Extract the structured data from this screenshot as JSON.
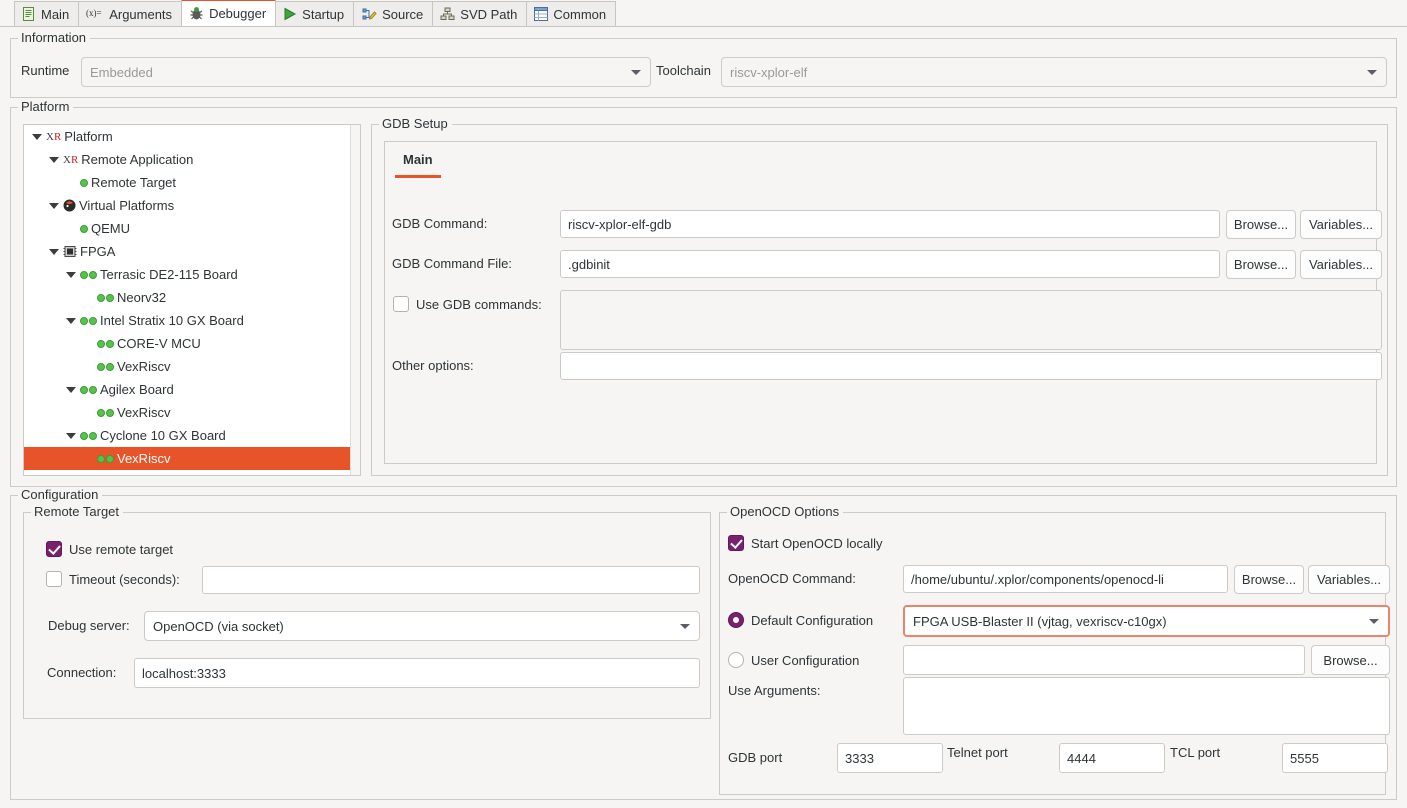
{
  "window": {
    "tabs": [
      {
        "label": "Main",
        "icon": "document-icon",
        "active": false
      },
      {
        "label": "Arguments",
        "icon": "arguments-icon",
        "active": false
      },
      {
        "label": "Debugger",
        "icon": "bug-icon",
        "active": true
      },
      {
        "label": "Startup",
        "icon": "play-icon",
        "active": false
      },
      {
        "label": "Source",
        "icon": "source-edit-icon",
        "active": false
      },
      {
        "label": "SVD Path",
        "icon": "hierarchy-icon",
        "active": false
      },
      {
        "label": "Common",
        "icon": "table-icon",
        "active": false
      }
    ]
  },
  "information": {
    "legend": "Information",
    "runtime_label": "Runtime",
    "runtime_value": "Embedded",
    "toolchain_label": "Toolchain",
    "toolchain_value": "riscv-xplor-elf"
  },
  "platform": {
    "legend": "Platform",
    "tree": [
      {
        "label": "Platform",
        "indent": 0,
        "twisty": "open",
        "icon": "xr-icon",
        "selected": false
      },
      {
        "label": "Remote Application",
        "indent": 1,
        "twisty": "open",
        "icon": "xr-icon",
        "selected": false
      },
      {
        "label": "Remote Target",
        "indent": 2,
        "twisty": "none",
        "icon": "green-dot-icon",
        "selected": false
      },
      {
        "label": "Virtual Platforms",
        "indent": 1,
        "twisty": "open",
        "icon": "qemu-icon",
        "selected": false
      },
      {
        "label": "QEMU",
        "indent": 2,
        "twisty": "none",
        "icon": "green-dot-icon",
        "selected": false
      },
      {
        "label": "FPGA",
        "indent": 1,
        "twisty": "open",
        "icon": "chip-icon",
        "selected": false
      },
      {
        "label": "Terrasic DE2-115 Board",
        "indent": 2,
        "twisty": "open",
        "icon": "dual-dot-icon",
        "selected": false
      },
      {
        "label": "Neorv32",
        "indent": 3,
        "twisty": "none",
        "icon": "dual-dot-icon",
        "selected": false
      },
      {
        "label": "Intel Stratix 10 GX Board",
        "indent": 2,
        "twisty": "open",
        "icon": "dual-dot-icon",
        "selected": false
      },
      {
        "label": "CORE-V MCU",
        "indent": 3,
        "twisty": "none",
        "icon": "dual-dot-icon",
        "selected": false
      },
      {
        "label": "VexRiscv",
        "indent": 3,
        "twisty": "none",
        "icon": "dual-dot-icon",
        "selected": false
      },
      {
        "label": "Agilex Board",
        "indent": 2,
        "twisty": "open",
        "icon": "dual-dot-icon",
        "selected": false
      },
      {
        "label": "VexRiscv",
        "indent": 3,
        "twisty": "none",
        "icon": "dual-dot-icon",
        "selected": false
      },
      {
        "label": "Cyclone 10 GX Board",
        "indent": 2,
        "twisty": "open",
        "icon": "dual-dot-icon",
        "selected": false
      },
      {
        "label": "VexRiscv",
        "indent": 3,
        "twisty": "none",
        "icon": "dual-dot-icon",
        "selected": true
      }
    ],
    "selection_color": "#e8542a"
  },
  "gdb_setup": {
    "legend": "GDB Setup",
    "tabs": [
      {
        "label": "Main",
        "active": true
      }
    ],
    "gdb_command_label": "GDB Command:",
    "gdb_command_value": "riscv-xplor-elf-gdb",
    "gdb_command_file_label": "GDB Command File:",
    "gdb_command_file_value": ".gdbinit",
    "use_gdb_commands_label": "Use GDB commands:",
    "use_gdb_commands_checked": false,
    "use_gdb_commands_value": "",
    "other_options_label": "Other options:",
    "other_options_value": "",
    "browse_label": "Browse...",
    "variables_label": "Variables..."
  },
  "configuration": {
    "legend": "Configuration",
    "remote_target": {
      "legend": "Remote Target",
      "use_remote_target_label": "Use remote target",
      "use_remote_target_checked": true,
      "timeout_label": "Timeout (seconds):",
      "timeout_checked": false,
      "timeout_value": "",
      "debug_server_label": "Debug server:",
      "debug_server_value": "OpenOCD (via socket)",
      "connection_label": "Connection:",
      "connection_value": "localhost:3333"
    },
    "openocd": {
      "legend": "OpenOCD Options",
      "start_locally_label": "Start OpenOCD locally",
      "start_locally_checked": true,
      "command_label": "OpenOCD Command:",
      "command_value": "/home/ubuntu/.xplor/components/openocd-li",
      "browse_label": "Browse...",
      "variables_label": "Variables...",
      "default_config_label": "Default Configuration",
      "default_config_selected": true,
      "default_config_value": "FPGA USB-Blaster II (vjtag, vexriscv-c10gx)",
      "user_config_label": "User Configuration",
      "user_config_selected": false,
      "user_config_value": "",
      "user_config_browse_label": "Browse...",
      "use_arguments_label": "Use Arguments:",
      "use_arguments_value": "",
      "gdb_port_label": "GDB port",
      "gdb_port_value": "3333",
      "telnet_port_label": "Telnet port",
      "telnet_port_value": "4444",
      "tcl_port_label": "TCL port",
      "tcl_port_value": "5555"
    }
  },
  "colors": {
    "accent": "#e8542a",
    "check": "#77216f",
    "focus_border": "#e8866a"
  }
}
